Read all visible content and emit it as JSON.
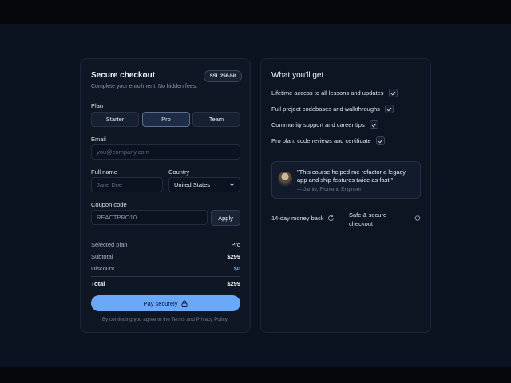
{
  "checkout": {
    "title": "Secure checkout",
    "subtitle": "Complete your enrollment. No hidden fees.",
    "badge": "SSL 256-bit",
    "plan_label": "Plan",
    "plans": [
      "Starter",
      "Pro",
      "Team"
    ],
    "selected_plan_index": 1,
    "email_label": "Email",
    "email_placeholder": "you@company.com",
    "fullname_label": "Full name",
    "fullname_placeholder": "Jane Doe",
    "country_label": "Country",
    "country_value": "United States",
    "coupon_label": "Coupon code",
    "coupon_value": "REACTPRO10",
    "apply_label": "Apply",
    "summary": {
      "selected_plan_label": "Selected plan",
      "selected_plan_value": "Pro",
      "subtotal_label": "Subtotal",
      "subtotal_value": "$299",
      "discount_label": "Discount",
      "discount_value": "$0",
      "total_label": "Total",
      "total_value": "$299"
    },
    "pay_label": "Pay securely",
    "terms": "By continuing you agree to the Terms and Privacy Policy."
  },
  "benefits": {
    "title": "What you'll get",
    "items": [
      "Lifetime access to all lessons and updates",
      "Full project codebases and walkthroughs",
      "Community support and career tips",
      "Pro plan: code reviews and certificate"
    ],
    "testimonial": {
      "quote": "\"This course helped me refactor a legacy app and ship features twice as fast.\"",
      "author": "— Jamie, Frontend Engineer"
    },
    "guarantee": "14-day money back",
    "secure": "Safe & secure checkout"
  },
  "colors": {
    "accent": "#6aa9f7",
    "background": "#0b1220",
    "discount": "#6aa9f7"
  }
}
